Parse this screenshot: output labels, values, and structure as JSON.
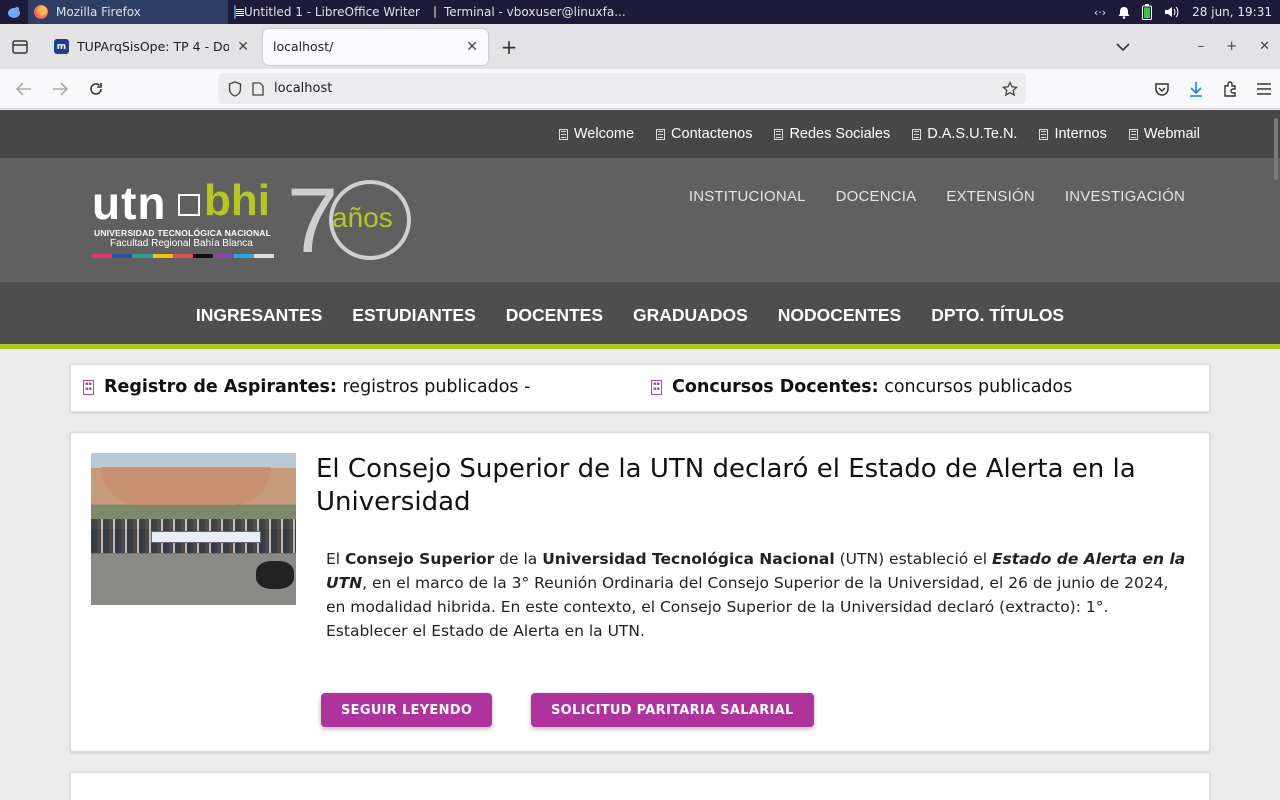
{
  "taskbar": {
    "tasks": [
      {
        "label": "Mozilla Firefox"
      },
      {
        "label": "Untitled 1 - LibreOffice Writer"
      },
      {
        "label": "Terminal - vboxuser@linuxfa..."
      }
    ],
    "clock": "28 jun, 19:31"
  },
  "browser": {
    "tabs": [
      {
        "title": "TUPArqSisOpe: TP 4 - Docker"
      },
      {
        "title": "localhost/"
      }
    ],
    "url": "localhost"
  },
  "site": {
    "toplinks": [
      "Welcome",
      "Contactenos",
      "Redes Sociales",
      "D.A.S.U.Te.N.",
      "Internos",
      "Webmail"
    ],
    "logo": {
      "utn": "utn",
      "bhi": "bhi",
      "university": "UNIVERSIDAD TECNOLÓGICA NACIONAL",
      "faculty": "Facultad Regional Bahía Blanca",
      "seventy": "7",
      "anos": "años"
    },
    "mainmenu": [
      "INSTITUCIONAL",
      "DOCENCIA",
      "EXTENSIÓN",
      "INVESTIGACIÓN"
    ],
    "secondmenu": [
      "INGRESANTES",
      "ESTUDIANTES",
      "DOCENTES",
      "GRADUADOS",
      "NODOCENTES",
      "DPTO. TÍTULOS"
    ],
    "ticker": [
      {
        "bold": "Registro de Aspirantes:",
        "text": "registros publicados -"
      },
      {
        "bold": "Concursos Docentes:",
        "text": "concursos publicados"
      }
    ],
    "article": {
      "title": "El Consejo Superior de la UTN declaró el Estado de Alerta en la Universidad",
      "body": {
        "p1": "El ",
        "b1": "Consejo Superior",
        "p2": " de la ",
        "b2": "Universidad Tecnológica Nacional",
        "p3": " (UTN) estableció el ",
        "i1": "Estado de Alerta en la UTN",
        "p4": ", en el marco de la 3° Reunión Ordinaria del Consejo Superior de la Universidad, el 26 de junio de 2024, en modalidad hibrida. En este contexto, el Consejo Superior de la Universidad declaró (extracto): 1°. Establecer el Estado de Alerta en la UTN."
      },
      "buttons": [
        "SEGUIR LEYENDO",
        "SOLICITUD PARITARIA SALARIAL"
      ]
    }
  },
  "colors": {
    "accent_green": "#aec81e",
    "button_magenta": "#b0329e"
  }
}
